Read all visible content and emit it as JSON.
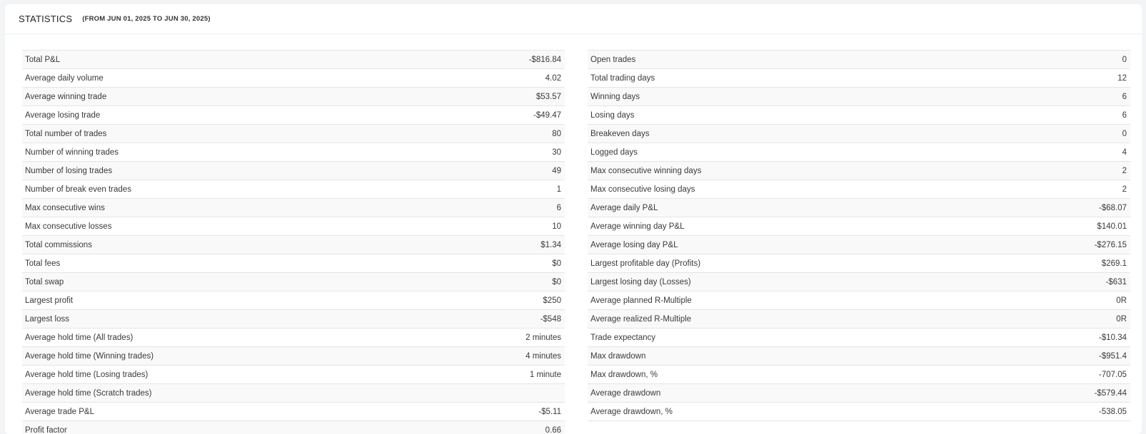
{
  "header": {
    "title": "STATISTICS",
    "subtitle": "(FROM JUN 01, 2025 TO JUN 30, 2025)"
  },
  "left_stats": [
    {
      "label": "Total P&L",
      "value": "-$816.84"
    },
    {
      "label": "Average daily volume",
      "value": "4.02"
    },
    {
      "label": "Average winning trade",
      "value": "$53.57"
    },
    {
      "label": "Average losing trade",
      "value": "-$49.47"
    },
    {
      "label": "Total number of trades",
      "value": "80"
    },
    {
      "label": "Number of winning trades",
      "value": "30"
    },
    {
      "label": "Number of losing trades",
      "value": "49"
    },
    {
      "label": "Number of break even trades",
      "value": "1"
    },
    {
      "label": "Max consecutive wins",
      "value": "6"
    },
    {
      "label": "Max consecutive losses",
      "value": "10"
    },
    {
      "label": "Total commissions",
      "value": "$1.34"
    },
    {
      "label": "Total fees",
      "value": "$0"
    },
    {
      "label": "Total swap",
      "value": "$0"
    },
    {
      "label": "Largest profit",
      "value": "$250"
    },
    {
      "label": "Largest loss",
      "value": "-$548"
    },
    {
      "label": "Average hold time (All trades)",
      "value": "2 minutes"
    },
    {
      "label": "Average hold time (Winning trades)",
      "value": "4 minutes"
    },
    {
      "label": "Average hold time (Losing trades)",
      "value": "1 minute"
    },
    {
      "label": "Average hold time (Scratch trades)",
      "value": ""
    },
    {
      "label": "Average trade P&L",
      "value": "-$5.11"
    },
    {
      "label": "Profit factor",
      "value": "0.66"
    }
  ],
  "right_stats": [
    {
      "label": "Open trades",
      "value": "0"
    },
    {
      "label": "Total trading days",
      "value": "12"
    },
    {
      "label": "Winning days",
      "value": "6"
    },
    {
      "label": "Losing days",
      "value": "6"
    },
    {
      "label": "Breakeven days",
      "value": "0"
    },
    {
      "label": "Logged days",
      "value": "4"
    },
    {
      "label": "Max consecutive winning days",
      "value": "2"
    },
    {
      "label": "Max consecutive losing days",
      "value": "2"
    },
    {
      "label": "Average daily P&L",
      "value": "-$68.07"
    },
    {
      "label": "Average winning day P&L",
      "value": "$140.01"
    },
    {
      "label": "Average losing day P&L",
      "value": "-$276.15"
    },
    {
      "label": "Largest profitable day (Profits)",
      "value": "$269.1"
    },
    {
      "label": "Largest losing day (Losses)",
      "value": "-$631"
    },
    {
      "label": "Average planned R-Multiple",
      "value": "0R"
    },
    {
      "label": "Average realized R-Multiple",
      "value": "0R"
    },
    {
      "label": "Trade expectancy",
      "value": "-$10.34"
    },
    {
      "label": "Max drawdown",
      "value": "-$951.4"
    },
    {
      "label": "Max drawdown, %",
      "value": "-707.05"
    },
    {
      "label": "Average drawdown",
      "value": "-$579.44"
    },
    {
      "label": "Average drawdown, %",
      "value": "-538.05"
    }
  ]
}
